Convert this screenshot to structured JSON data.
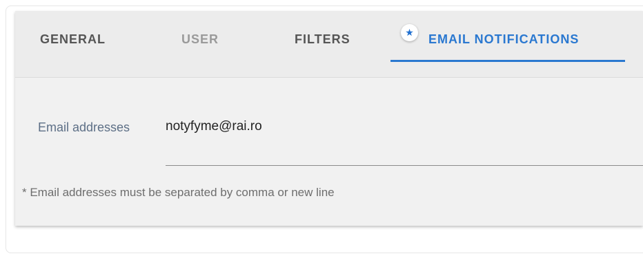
{
  "tabs": {
    "general": "GENERAL",
    "user": "USER",
    "filters": "FILTERS",
    "email_notifications": "EMAIL NOTIFICATIONS",
    "active": "email_notifications",
    "modified_marker": "★"
  },
  "email_form": {
    "label": "Email addresses",
    "value": "notyfyme@rai.ro",
    "hint": "* Email addresses must be separated by comma or new line"
  },
  "colors": {
    "accent": "#2a78d0",
    "panel_background": "#f1f1f1",
    "tabbar_background": "#ececec"
  }
}
